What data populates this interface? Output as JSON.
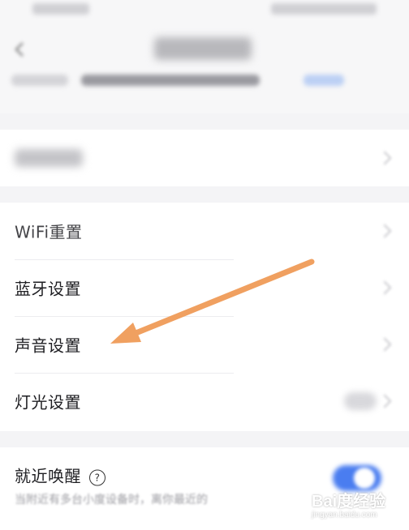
{
  "settings": {
    "wifi_reset": "WiFi重置",
    "bluetooth": "蓝牙设置",
    "sound": "声音设置",
    "light": "灯光设置"
  },
  "nearby_wake": {
    "label": "就近唤醒",
    "help_glyph": "?",
    "description": "当附近有多台小度设备时，离你最近的",
    "toggle_on": true
  },
  "watermark": {
    "main": "Bai度经验",
    "sub": "jingyan.baidu.com"
  },
  "colors": {
    "accent_blue": "#4a7df0",
    "arrow_orange": "#f0a060",
    "background": "#f4f4f6"
  }
}
